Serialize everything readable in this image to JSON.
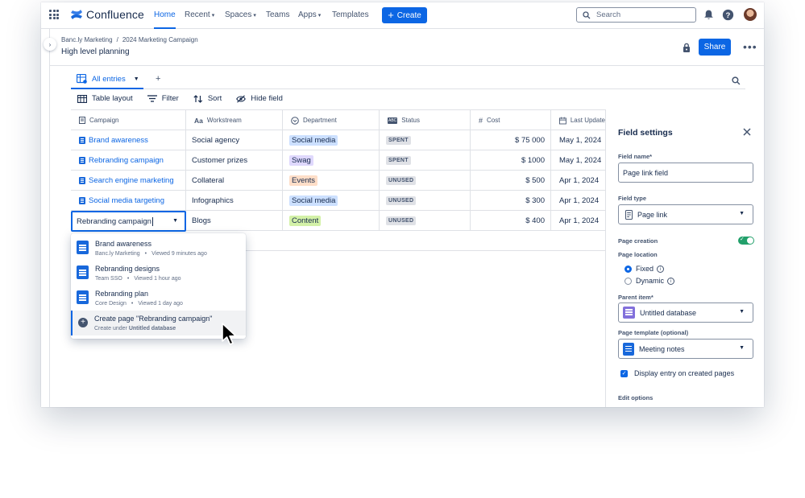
{
  "nav": {
    "logo": "Confluence",
    "items": [
      "Home",
      "Recent",
      "Spaces",
      "Teams",
      "Apps",
      "Templates"
    ],
    "create_label": "Create",
    "search_placeholder": "Search"
  },
  "page": {
    "breadcrumbs": [
      "Banc.ly Marketing",
      "2024 Marketing Campaign"
    ],
    "breadcrumb_sep": "/",
    "title": "High level planning",
    "share_label": "Share"
  },
  "database": {
    "tab_label": "All entries",
    "toolbar": [
      "Table layout",
      "Filter",
      "Sort",
      "Hide field"
    ],
    "columns": [
      "Campaign",
      "Workstream",
      "Department",
      "Status",
      "Cost",
      "Last Update"
    ],
    "rows": [
      {
        "campaign": "Brand awareness",
        "workstream": "Social agency",
        "department": "Social media",
        "status": "SPENT",
        "cost": "$ 75 000",
        "updated": "May 1, 2024"
      },
      {
        "campaign": "Rebranding campaign",
        "workstream": "Customer prizes",
        "department": "Swag",
        "status": "SPENT",
        "cost": "$ 1000",
        "updated": "May 1, 2024"
      },
      {
        "campaign": "Search engine marketing",
        "workstream": "Collateral",
        "department": "Events",
        "status": "UNUSED",
        "cost": "$ 500",
        "updated": "Apr 1, 2024"
      },
      {
        "campaign": "Social media targeting",
        "workstream": "Infographics",
        "department": "Social media",
        "status": "UNUSED",
        "cost": "$ 300",
        "updated": "Apr 1, 2024"
      },
      {
        "campaign": "",
        "workstream": "Blogs",
        "department": "Content",
        "status": "UNUSED",
        "cost": "$ 400",
        "updated": "Apr 1, 2024"
      }
    ],
    "editing_value": "Rebranding campaign",
    "colors": {
      "spent_bg": "#dfe1e6",
      "unused_bg": "#dfe1e6",
      "social_bg": "#cce0ff",
      "swag_bg": "#dfd8fd",
      "events_bg": "#fedec8",
      "content_bg": "#d3f1a7"
    }
  },
  "dropdown": {
    "items": [
      {
        "title": "Brand awareness",
        "space": "Banc.ly Marketing",
        "viewed": "Viewed 9 minutes ago"
      },
      {
        "title": "Rebranding designs",
        "space": "Team SSO",
        "viewed": "Viewed 1 hour ago"
      },
      {
        "title": "Rebranding plan",
        "space": "Core Design",
        "viewed": "Viewed 1 day ago"
      }
    ],
    "create_title": "Create page \"Rebranding campaign\"",
    "create_sub_prefix": "Create under",
    "create_sub_target": "Untitled database"
  },
  "field_settings": {
    "title": "Field settings",
    "field_name_label": "Field name*",
    "field_name_value": "Page link field",
    "field_type_label": "Field type",
    "field_type_value": "Page link",
    "page_creation_label": "Page creation",
    "page_creation_on": true,
    "page_location_label": "Page location",
    "location_options": [
      "Fixed",
      "Dynamic"
    ],
    "location_selected": "Fixed",
    "parent_item_label": "Parent item*",
    "parent_item_value": "Untitled database",
    "template_label": "Page template (optional)",
    "template_value": "Meeting notes",
    "display_entry_label": "Display entry on created pages",
    "display_entry_checked": true,
    "edit_options_label": "Edit options"
  }
}
